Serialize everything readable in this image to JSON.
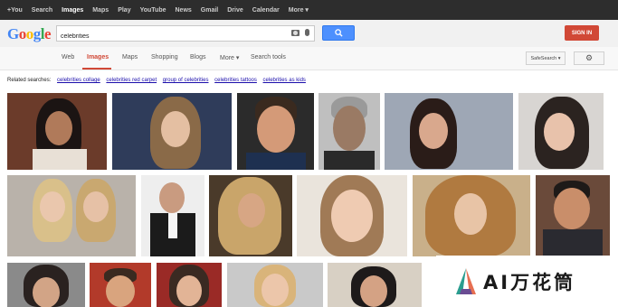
{
  "topbar": {
    "items": [
      "+You",
      "Search",
      "Images",
      "Maps",
      "Play",
      "YouTube",
      "News",
      "Gmail",
      "Drive",
      "Calendar",
      "More ▾"
    ],
    "active_index": 2
  },
  "header": {
    "logo_letters": [
      {
        "ch": "G",
        "color": "#4285f4"
      },
      {
        "ch": "o",
        "color": "#ea4335"
      },
      {
        "ch": "o",
        "color": "#fbbc05"
      },
      {
        "ch": "g",
        "color": "#4285f4"
      },
      {
        "ch": "l",
        "color": "#34a853"
      },
      {
        "ch": "e",
        "color": "#ea4335"
      }
    ],
    "search_value": "celebrities",
    "signin_label": "SIGN IN"
  },
  "nav": {
    "tabs": [
      "Web",
      "Images",
      "Maps",
      "Shopping",
      "Blogs",
      "More ▾",
      "Search tools"
    ],
    "active_index": 1,
    "safesearch_label": "SafeSearch ▾",
    "settings_icon": "gear-icon"
  },
  "related": {
    "prefix": "Related searches:",
    "links": [
      "celebrities collage",
      "celebrities red carpet",
      "group of celebrities",
      "celebrities tattoos",
      "celebrities as kids"
    ]
  },
  "watermark": {
    "text": "AI万花筒"
  },
  "colors": {
    "accent_red": "#d14836",
    "button_blue": "#4d90fe",
    "link_blue": "#1a0dab"
  }
}
